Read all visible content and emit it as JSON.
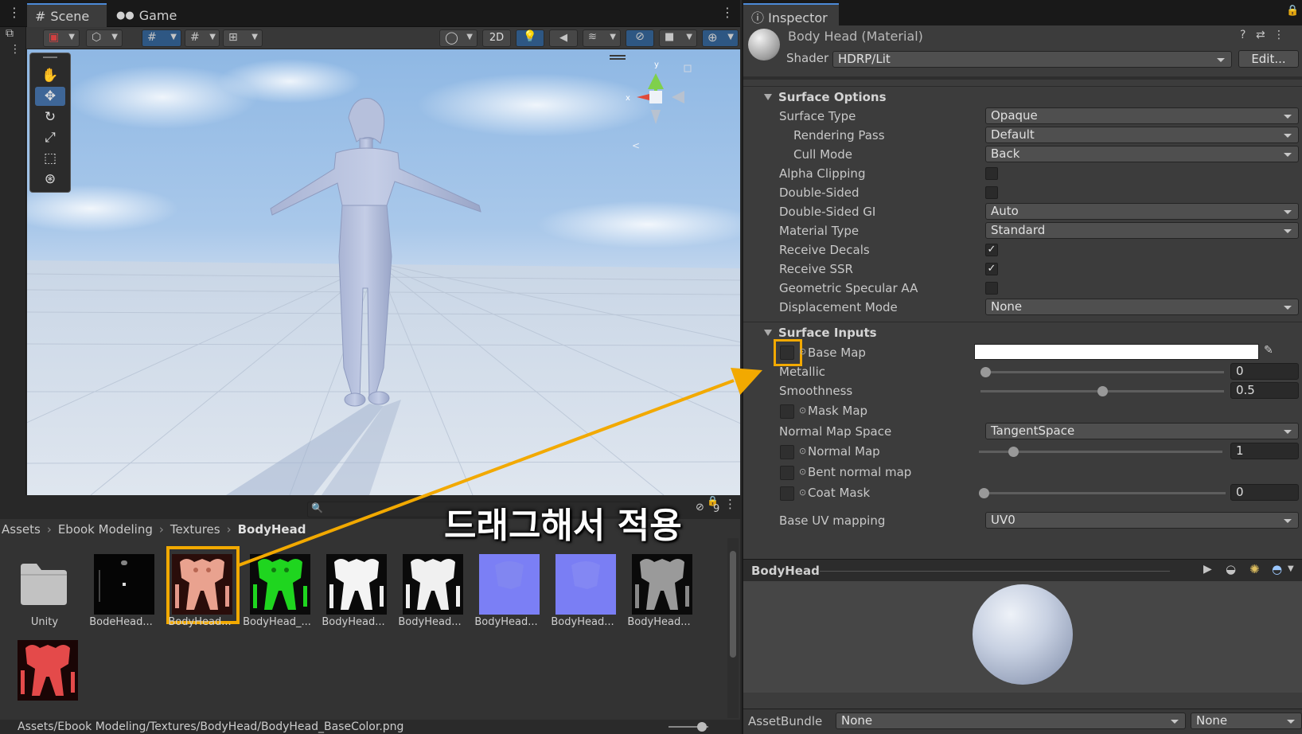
{
  "scene_panel": {
    "tabs": [
      "Scene",
      "Game"
    ],
    "toolbar": {
      "mode_2d": "2D"
    },
    "gizmo_axis": {
      "y": "y",
      "x": "x"
    }
  },
  "project_panel": {
    "hidden_count": "9",
    "breadcrumb": [
      "Assets",
      "Ebook Modeling",
      "Textures",
      "BodyHead"
    ],
    "assets": [
      {
        "label": "Unity",
        "kind": "folder"
      },
      {
        "label": "BodeHead...",
        "kind": "dark"
      },
      {
        "label": "BodyHead...",
        "kind": "basecolor",
        "selected": true
      },
      {
        "label": "BodyHead_...",
        "kind": "green"
      },
      {
        "label": "BodyHead...",
        "kind": "white"
      },
      {
        "label": "BodyHead...",
        "kind": "white"
      },
      {
        "label": "BodyHead...",
        "kind": "normal"
      },
      {
        "label": "BodyHead...",
        "kind": "normal"
      },
      {
        "label": "BodyHead...",
        "kind": "grey"
      },
      {
        "label": "",
        "kind": "red"
      }
    ],
    "status_path": "Assets/Ebook Modeling/Textures/BodyHead/BodyHead_BaseColor.png"
  },
  "inspector": {
    "tab": "Inspector",
    "material_name": "Body Head (Material)",
    "shader_label": "Shader",
    "shader_value": "HDRP/Lit",
    "edit_button": "Edit...",
    "surface_options": {
      "title": "Surface Options",
      "surface_type": {
        "label": "Surface Type",
        "value": "Opaque"
      },
      "rendering_pass": {
        "label": "Rendering Pass",
        "value": "Default"
      },
      "cull_mode": {
        "label": "Cull Mode",
        "value": "Back"
      },
      "alpha_clipping": {
        "label": "Alpha Clipping",
        "checked": false
      },
      "double_sided": {
        "label": "Double-Sided",
        "checked": false
      },
      "double_sided_gi": {
        "label": "Double-Sided GI",
        "value": "Auto"
      },
      "material_type": {
        "label": "Material Type",
        "value": "Standard"
      },
      "receive_decals": {
        "label": "Receive Decals",
        "checked": true
      },
      "receive_ssr": {
        "label": "Receive SSR",
        "checked": true
      },
      "geometric_specular_aa": {
        "label": "Geometric Specular AA",
        "checked": false
      },
      "displacement_mode": {
        "label": "Displacement Mode",
        "value": "None"
      }
    },
    "surface_inputs": {
      "title": "Surface Inputs",
      "base_map": {
        "label": "Base Map",
        "color": "#ffffff"
      },
      "metallic": {
        "label": "Metallic",
        "value": "0",
        "fraction": 0.0
      },
      "smoothness": {
        "label": "Smoothness",
        "value": "0.5",
        "fraction": 0.5
      },
      "mask_map": {
        "label": "Mask Map"
      },
      "normal_map_space": {
        "label": "Normal Map Space",
        "value": "TangentSpace"
      },
      "normal_map": {
        "label": "Normal Map",
        "value": "1",
        "fraction": 0.125
      },
      "bent_normal_map": {
        "label": "Bent normal map"
      },
      "coat_mask": {
        "label": "Coat Mask",
        "value": "0",
        "fraction": 0.0
      },
      "base_uv_mapping": {
        "label": "Base UV mapping",
        "value": "UV0"
      }
    },
    "preview": {
      "title": "BodyHead"
    },
    "assetbundle": {
      "label": "AssetBundle",
      "value": "None",
      "variant": "None"
    }
  },
  "annotation": {
    "text": "드래그해서 적용",
    "color": "#f2a900"
  }
}
